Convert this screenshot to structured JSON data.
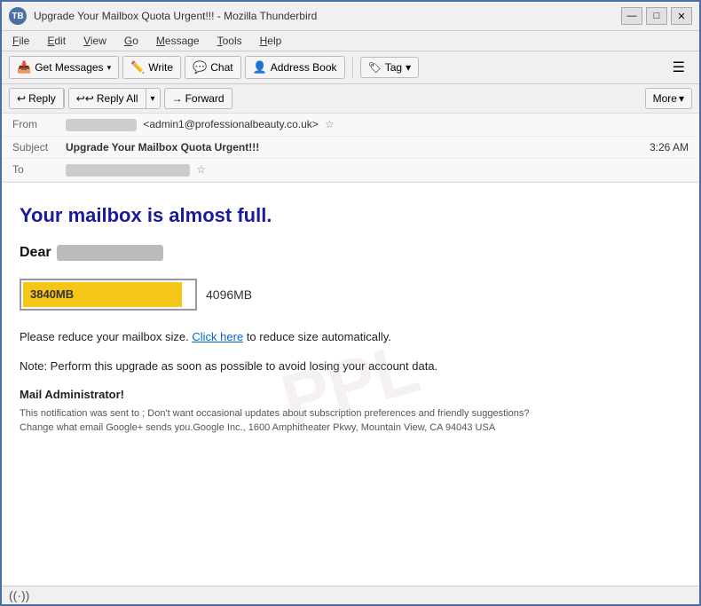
{
  "window": {
    "title": "Upgrade Your Mailbox Quota Urgent!!! - Mozilla Thunderbird",
    "icon_label": "TB"
  },
  "title_controls": {
    "minimize": "—",
    "maximize": "□",
    "close": "✕"
  },
  "menu": {
    "items": [
      "File",
      "Edit",
      "View",
      "Go",
      "Message",
      "Tools",
      "Help"
    ]
  },
  "toolbar": {
    "get_messages": "Get Messages",
    "write": "Write",
    "chat": "Chat",
    "address_book": "Address Book",
    "tag": "Tag",
    "tag_arrow": "▾"
  },
  "action_bar": {
    "reply": "Reply",
    "reply_all": "Reply All",
    "forward": "Forward",
    "more": "More"
  },
  "email_header": {
    "from_label": "From",
    "from_blur": "██████",
    "from_email": "<admin1@professionalbeauty.co.uk>",
    "subject_label": "Subject",
    "subject": "Upgrade Your Mailbox Quota Urgent!!!",
    "time": "3:26 AM",
    "to_label": "To",
    "to_blur": "████████████████"
  },
  "email_body": {
    "watermark": "PPL",
    "headline": "Your mailbox is almost full.",
    "dear": "Dear",
    "dear_blur": "██████████",
    "quota_used": "3840MB",
    "quota_fill_percent": "93",
    "quota_total": "4096MB",
    "paragraph1_pre": "Please reduce your mailbox size.",
    "click_here": "Click here",
    "paragraph1_post": "to reduce size automatically.",
    "note": "Note: Perform this upgrade as soon as possible to avoid  losing your account data.",
    "mail_admin": "Mail Administrator!",
    "footer": "This notification was sent to ; Don't want occasional updates about subscription preferences and friendly suggestions?\nChange what email Google+ sends you.Google Inc., 1600 Amphitheater Pkwy, Mountain View, CA 94043 USA"
  },
  "status_bar": {
    "wifi_icon": "((·))"
  }
}
